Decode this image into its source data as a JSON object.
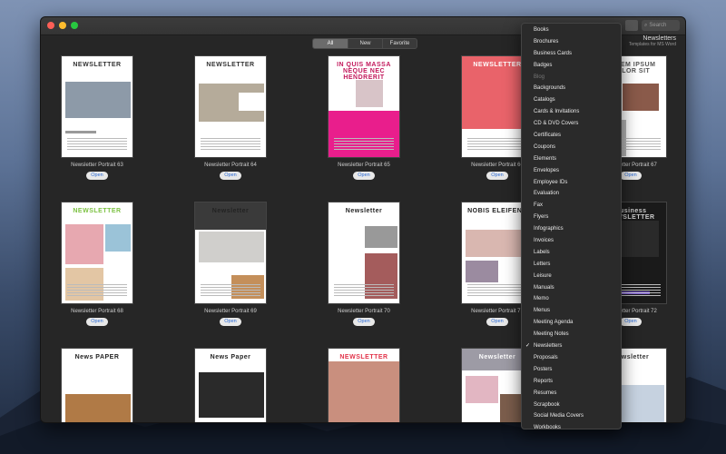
{
  "window": {
    "tabs": [
      {
        "label": "All",
        "active": true
      },
      {
        "label": "New",
        "active": false
      },
      {
        "label": "Favorite",
        "active": false
      }
    ],
    "search_placeholder": "Search",
    "header_title": "Newsletters",
    "header_subtitle": "Templates for MS Word"
  },
  "templates": [
    {
      "name": "Newsletter Portrait 63",
      "open_label": "Open",
      "thumb_title": "NEWSLETTER"
    },
    {
      "name": "Newsletter Portrait 64",
      "open_label": "Open",
      "thumb_title": "NEWSLETTER"
    },
    {
      "name": "Newsletter Portrait 65",
      "open_label": "Open",
      "thumb_title": "IN QUIS MASSA NEQUE NEC HENDRERIT"
    },
    {
      "name": "Newsletter Portrait 66",
      "open_label": "Open",
      "thumb_title": "NEWSLETTER"
    },
    {
      "name": "Newsletter Portrait 67",
      "open_label": "Open",
      "thumb_title": "LOREM IPSUM DOLOR SIT"
    },
    {
      "name": "Newsletter Portrait 68",
      "open_label": "Open",
      "thumb_title": "NEWSLETTER"
    },
    {
      "name": "Newsletter Portrait 69",
      "open_label": "Open",
      "thumb_title": "Newsletter"
    },
    {
      "name": "Newsletter Portrait 70",
      "open_label": "Open",
      "thumb_title": "Newsletter"
    },
    {
      "name": "Newsletter Portrait 71",
      "open_label": "Open",
      "thumb_title": "NOBIS ELEIFEND"
    },
    {
      "name": "Newsletter Portrait 72",
      "open_label": "Open",
      "thumb_title": "Business NEWSLETTER"
    },
    {
      "name": "",
      "open_label": "",
      "thumb_title": "News PAPER"
    },
    {
      "name": "",
      "open_label": "",
      "thumb_title": "News Paper"
    },
    {
      "name": "",
      "open_label": "",
      "thumb_title": "NEWSLETTER"
    },
    {
      "name": "",
      "open_label": "",
      "thumb_title": "Newsletter"
    },
    {
      "name": "",
      "open_label": "",
      "thumb_title": "Newsletter"
    }
  ],
  "category_menu": {
    "selected": "Newsletters",
    "items": [
      {
        "label": "Books",
        "enabled": true
      },
      {
        "label": "Brochures",
        "enabled": true
      },
      {
        "label": "Business Cards",
        "enabled": true
      },
      {
        "label": "Badges",
        "enabled": true
      },
      {
        "label": "Blog",
        "enabled": false
      },
      {
        "label": "Backgrounds",
        "enabled": true
      },
      {
        "label": "Catalogs",
        "enabled": true
      },
      {
        "label": "Cards & Invitations",
        "enabled": true
      },
      {
        "label": "CD & DVD Covers",
        "enabled": true
      },
      {
        "label": "Certificates",
        "enabled": true
      },
      {
        "label": "Coupons",
        "enabled": true
      },
      {
        "label": "Elements",
        "enabled": true
      },
      {
        "label": "Envelopes",
        "enabled": true
      },
      {
        "label": "Employee IDs",
        "enabled": true
      },
      {
        "label": "Evaluation",
        "enabled": true
      },
      {
        "label": "Fax",
        "enabled": true
      },
      {
        "label": "Flyers",
        "enabled": true
      },
      {
        "label": "Infographics",
        "enabled": true
      },
      {
        "label": "Invoices",
        "enabled": true
      },
      {
        "label": "Labels",
        "enabled": true
      },
      {
        "label": "Letters",
        "enabled": true
      },
      {
        "label": "Leisure",
        "enabled": true
      },
      {
        "label": "Manuals",
        "enabled": true
      },
      {
        "label": "Memo",
        "enabled": true
      },
      {
        "label": "Menus",
        "enabled": true
      },
      {
        "label": "Meeting Agenda",
        "enabled": true
      },
      {
        "label": "Meeting Notes",
        "enabled": true
      },
      {
        "label": "Newsletters",
        "enabled": true,
        "checked": true
      },
      {
        "label": "Proposals",
        "enabled": true
      },
      {
        "label": "Posters",
        "enabled": true
      },
      {
        "label": "Reports",
        "enabled": true
      },
      {
        "label": "Resumes",
        "enabled": true
      },
      {
        "label": "Scrapbook",
        "enabled": true
      },
      {
        "label": "Social Media Covers",
        "enabled": true
      },
      {
        "label": "Workbooks",
        "enabled": true
      }
    ]
  }
}
